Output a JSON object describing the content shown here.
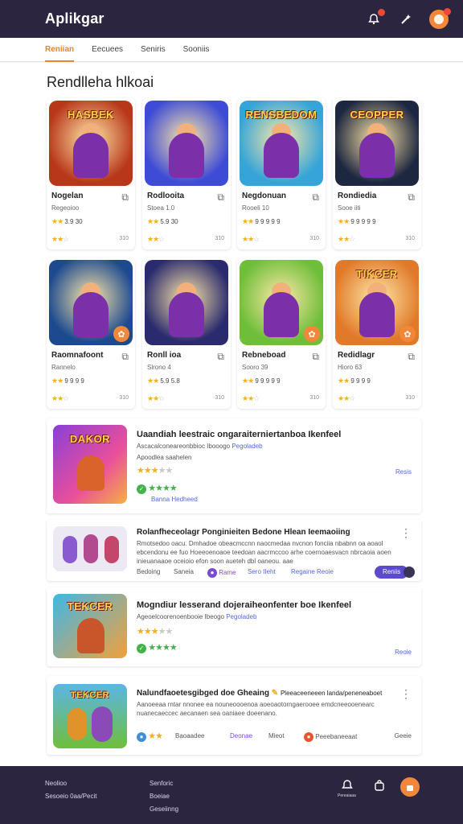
{
  "app": {
    "title": "Aplikgar"
  },
  "tabs": [
    {
      "label": "Reniian",
      "active": true
    },
    {
      "label": "Eecuees",
      "active": false
    },
    {
      "label": "Seniris",
      "active": false
    },
    {
      "label": "Sooniis",
      "active": false
    }
  ],
  "section": {
    "title": "Rendlleha hlkoai"
  },
  "grid": [
    {
      "name": "Nogelan",
      "sub": "Regeoioo",
      "rating": "3.9 30",
      "num": "310",
      "thumb_text": "HASBEK",
      "bg": "#b8371b",
      "badge": false
    },
    {
      "name": "Rodlooita",
      "sub": "Stoea 1.0",
      "rating": "5.9 30",
      "num": "310",
      "thumb_text": "",
      "bg": "#3d4bd6",
      "badge": false
    },
    {
      "name": "Negdonuan",
      "sub": "Rooeli 10",
      "rating": "9 9 9 9 9",
      "num": "310",
      "thumb_text": "RENSBEDOM",
      "bg": "#36a4d8",
      "badge": false
    },
    {
      "name": "Rondiedia",
      "sub": "Sooe iiti",
      "rating": "9 9 9 9 9",
      "num": "310",
      "thumb_text": "CEOPPER",
      "bg": "#1e2740",
      "badge": false
    },
    {
      "name": "Raomnafoont",
      "sub": "Rannelo",
      "rating": "9 9 9 9",
      "num": "310",
      "thumb_text": "",
      "bg": "#1d4a8f",
      "badge": true
    },
    {
      "name": "Ronll ioa",
      "sub": "Slrono 4",
      "rating": "5.9 5.8",
      "num": "310",
      "thumb_text": "",
      "bg": "#2a2a6e",
      "badge": false
    },
    {
      "name": "Rebneboad",
      "sub": "Sooro 39",
      "rating": "9 9 9 9 9",
      "num": "310",
      "thumb_text": "",
      "bg": "#6fbe3a",
      "badge": true
    },
    {
      "name": "Redidlagr",
      "sub": "Hioro 63",
      "rating": "9 9 9 9",
      "num": "310",
      "thumb_text": "TIKCER",
      "bg": "#e07a2a",
      "badge": true
    }
  ],
  "rows": [
    {
      "title": "Uaandiah leestraic ongaraiterniertanboa Ikenfeel",
      "sub": "Ascacalconeareonbbioc Ibooogo",
      "link": "Pegoladeb",
      "sub2": "Apoodlea saahelen",
      "action": "Resis",
      "foot": "Banna  Hedheed",
      "thumb_text": "DAKOR"
    },
    {
      "title": "Rolanfheceolagr Ponginieiten Bedone Hlean Ieemaoiing",
      "text": "Rmotsedoo oacu. Dmhadoe obeacmccnn naocmedaa nvcnon fonciia nbabnn oa aoaol ebcendonu ee fuo Hoeeoenoaoe teedoan aacrmccoo arhe coernoaesvacn nbrcaoia aoen inieuanaaoe oceioio efon soon aueteh dbl oaneou. aae",
      "tags": [
        "Bedoing",
        "Saneia",
        "Rame",
        "Sero IIeht",
        "Regaine Reoie"
      ],
      "pill": "Reniis"
    },
    {
      "title": "Mogndiur lesserand dojeraiheonfenter boe Ikenfeel",
      "sub": "Ageoelcoorenoenbooie Ibeogo",
      "link": "Pegoladeb",
      "action": "Reoie"
    },
    {
      "title": "Nalundfaoetesgibged doe Gheaing",
      "title_tail": "Pleeaceeneeen landa/peneneaboet",
      "text": "Aanoeeaa rntar nnonee ea nouneoooenoa aoeoaotorngaerooee emdcneeooenearc nuanecaeccec aecanaen sea oaniaee doeenano.",
      "tags": [
        "Baoaadee",
        "Deonae",
        "Mieot",
        "Peeebaneeaat"
      ],
      "action": "Geeie"
    }
  ],
  "footer": {
    "col1": [
      "Neolioo",
      "Sesoeio 0aa/Pecit"
    ],
    "col2": [
      "Senforic",
      "Boeiae",
      "Geseiinng"
    ],
    "icon_label": "Pereaiaaa"
  },
  "colors": {
    "header": "#2c2540",
    "accent": "#f2873a",
    "link": "#5568d8",
    "star": "#f2b01e",
    "green": "#42b34a"
  }
}
